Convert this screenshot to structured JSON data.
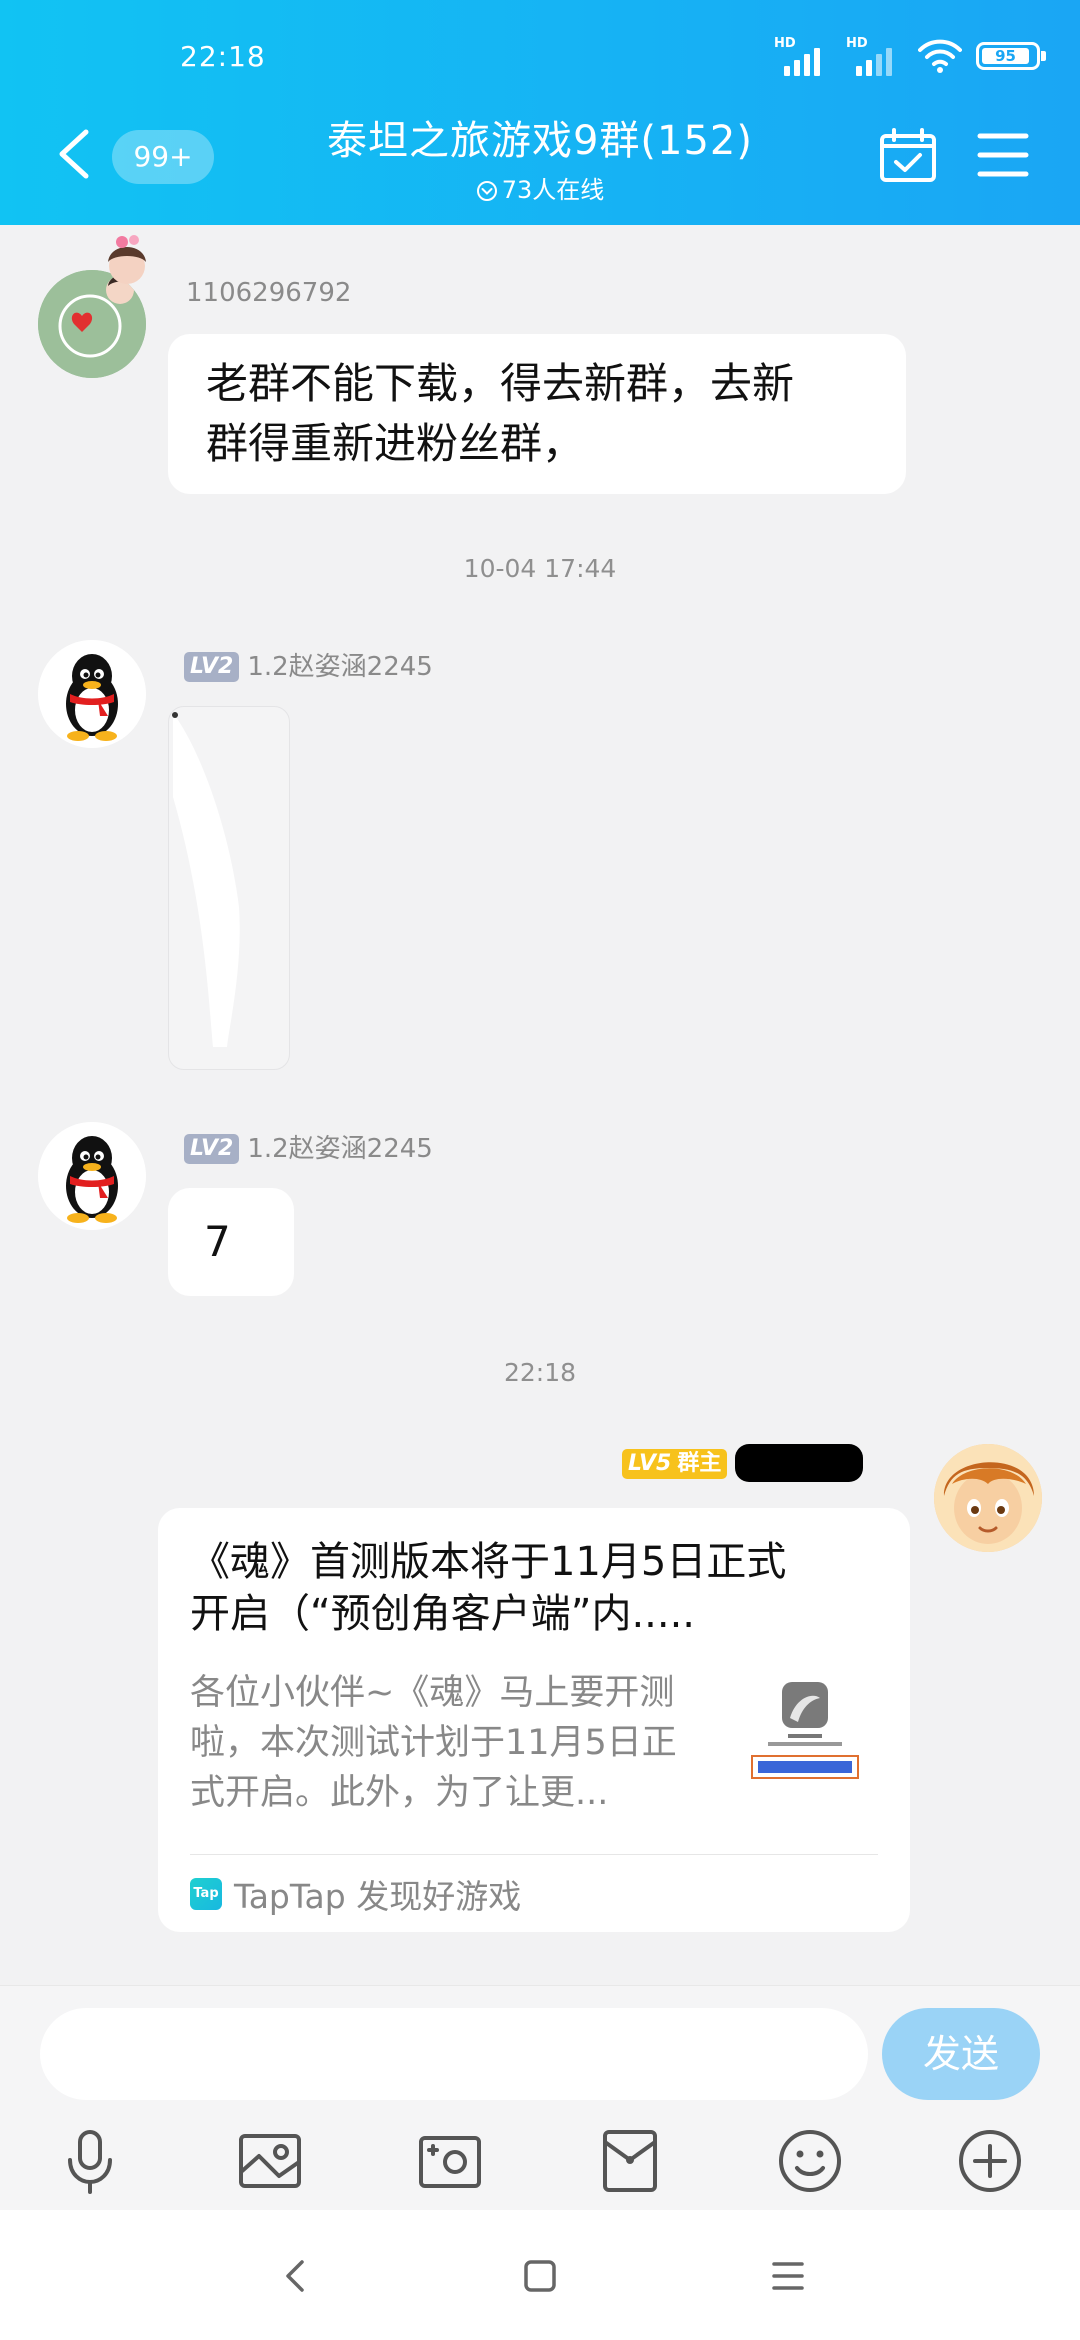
{
  "status_bar": {
    "time": "22:18",
    "battery": "95",
    "network_labels": [
      "HD",
      "HD"
    ]
  },
  "header": {
    "unread_count": "99+",
    "group_title": "泰坦之旅游戏9群(152)",
    "online_text": "73人在线"
  },
  "messages": [
    {
      "sender": "1106296792",
      "text_lines": [
        "老群不能下载，得去新群，去新",
        "群得重新进粉丝群，"
      ]
    },
    {
      "timestamp": "10-04  17:44"
    },
    {
      "level": "LV2",
      "sender": "1.2赵姿涵2245",
      "type": "image"
    },
    {
      "level": "LV2",
      "sender": "1.2赵姿涵2245",
      "text": "7"
    },
    {
      "timestamp": "22:18"
    },
    {
      "level": "LV5",
      "role": "群主",
      "type": "share-card",
      "card": {
        "title_lines": [
          "《魂》首测版本将于11月5日正式",
          "开启（“预创角客户端”内....."
        ],
        "desc_lines": [
          "各位小伙伴~《魂》马上要开测",
          "啦，本次测试计划于11月5日正",
          "式开启。此外，为了让更..."
        ],
        "source": "TapTap 发现好游戏",
        "source_logo": "Tap"
      }
    }
  ],
  "input": {
    "placeholder": "",
    "value": "",
    "send_label": "发送"
  },
  "toolbar": [
    "microphone-icon",
    "gallery-icon",
    "camera-icon",
    "red-packet-icon",
    "emoji-icon",
    "plus-icon"
  ],
  "colors": {
    "header_start": "#11c3f3",
    "header_end": "#1aa6f4",
    "send_button": "#9ad3f6",
    "lv_grey": "#a7b0c6",
    "lv_gold": "#f7c21c"
  }
}
